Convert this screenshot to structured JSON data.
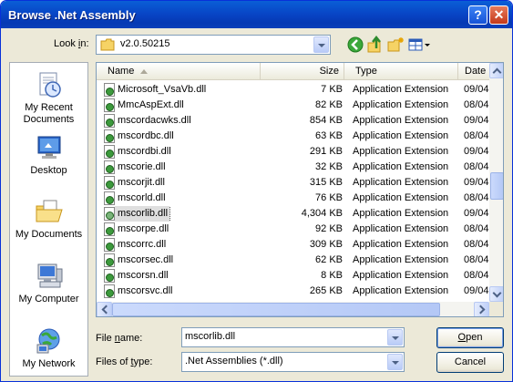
{
  "window": {
    "title": "Browse .Net Assembly",
    "help_label": "?",
    "close_label": "✕"
  },
  "lookin": {
    "label_prefix": "Look ",
    "label_underlined": "i",
    "label_suffix": "n:",
    "value": "v2.0.50215"
  },
  "toolbar": {
    "icons": [
      "back-icon",
      "up-folder-icon",
      "new-folder-icon",
      "views-menu-icon"
    ]
  },
  "places": [
    {
      "label": "My Recent Documents",
      "icon": "recent-documents-icon"
    },
    {
      "label": "Desktop",
      "icon": "desktop-icon"
    },
    {
      "label": "My Documents",
      "icon": "my-documents-icon"
    },
    {
      "label": "My Computer",
      "icon": "my-computer-icon"
    },
    {
      "label": "My Network",
      "icon": "my-network-icon"
    }
  ],
  "columns": {
    "name": "Name",
    "size": "Size",
    "type": "Type",
    "date": "Date"
  },
  "files": [
    {
      "name": "Microsoft_VsaVb.dll",
      "size": "7 KB",
      "type": "Application Extension",
      "date": "09/04"
    },
    {
      "name": "MmcAspExt.dll",
      "size": "82 KB",
      "type": "Application Extension",
      "date": "08/04"
    },
    {
      "name": "mscordacwks.dll",
      "size": "854 KB",
      "type": "Application Extension",
      "date": "09/04"
    },
    {
      "name": "mscordbc.dll",
      "size": "63 KB",
      "type": "Application Extension",
      "date": "08/04"
    },
    {
      "name": "mscordbi.dll",
      "size": "291 KB",
      "type": "Application Extension",
      "date": "09/04"
    },
    {
      "name": "mscorie.dll",
      "size": "32 KB",
      "type": "Application Extension",
      "date": "08/04"
    },
    {
      "name": "mscorjit.dll",
      "size": "315 KB",
      "type": "Application Extension",
      "date": "09/04"
    },
    {
      "name": "mscorld.dll",
      "size": "76 KB",
      "type": "Application Extension",
      "date": "08/04"
    },
    {
      "name": "mscorlib.dll",
      "size": "4,304 KB",
      "type": "Application Extension",
      "date": "09/04",
      "selected": true
    },
    {
      "name": "mscorpe.dll",
      "size": "92 KB",
      "type": "Application Extension",
      "date": "08/04"
    },
    {
      "name": "mscorrc.dll",
      "size": "309 KB",
      "type": "Application Extension",
      "date": "08/04"
    },
    {
      "name": "mscorsec.dll",
      "size": "62 KB",
      "type": "Application Extension",
      "date": "08/04"
    },
    {
      "name": "mscorsn.dll",
      "size": "8 KB",
      "type": "Application Extension",
      "date": "08/04"
    },
    {
      "name": "mscorsvc.dll",
      "size": "265 KB",
      "type": "Application Extension",
      "date": "09/04"
    }
  ],
  "scrollbar": {
    "vertical_position": 0.52
  },
  "filename": {
    "label_prefix": "File ",
    "label_underlined": "n",
    "label_suffix": "ame:",
    "value": "mscorlib.dll"
  },
  "filetype": {
    "label_prefix": "Files of ",
    "label_underlined": "t",
    "label_suffix": "ype:",
    "value": ".Net Assemblies (*.dll)"
  },
  "buttons": {
    "open_underlined": "O",
    "open_rest": "pen",
    "cancel": "Cancel"
  },
  "colors": {
    "title_bar": "#0846c7",
    "dialog_bg": "#ece9d8",
    "close_button": "#c3391a",
    "selection": "#dfdfdf"
  }
}
